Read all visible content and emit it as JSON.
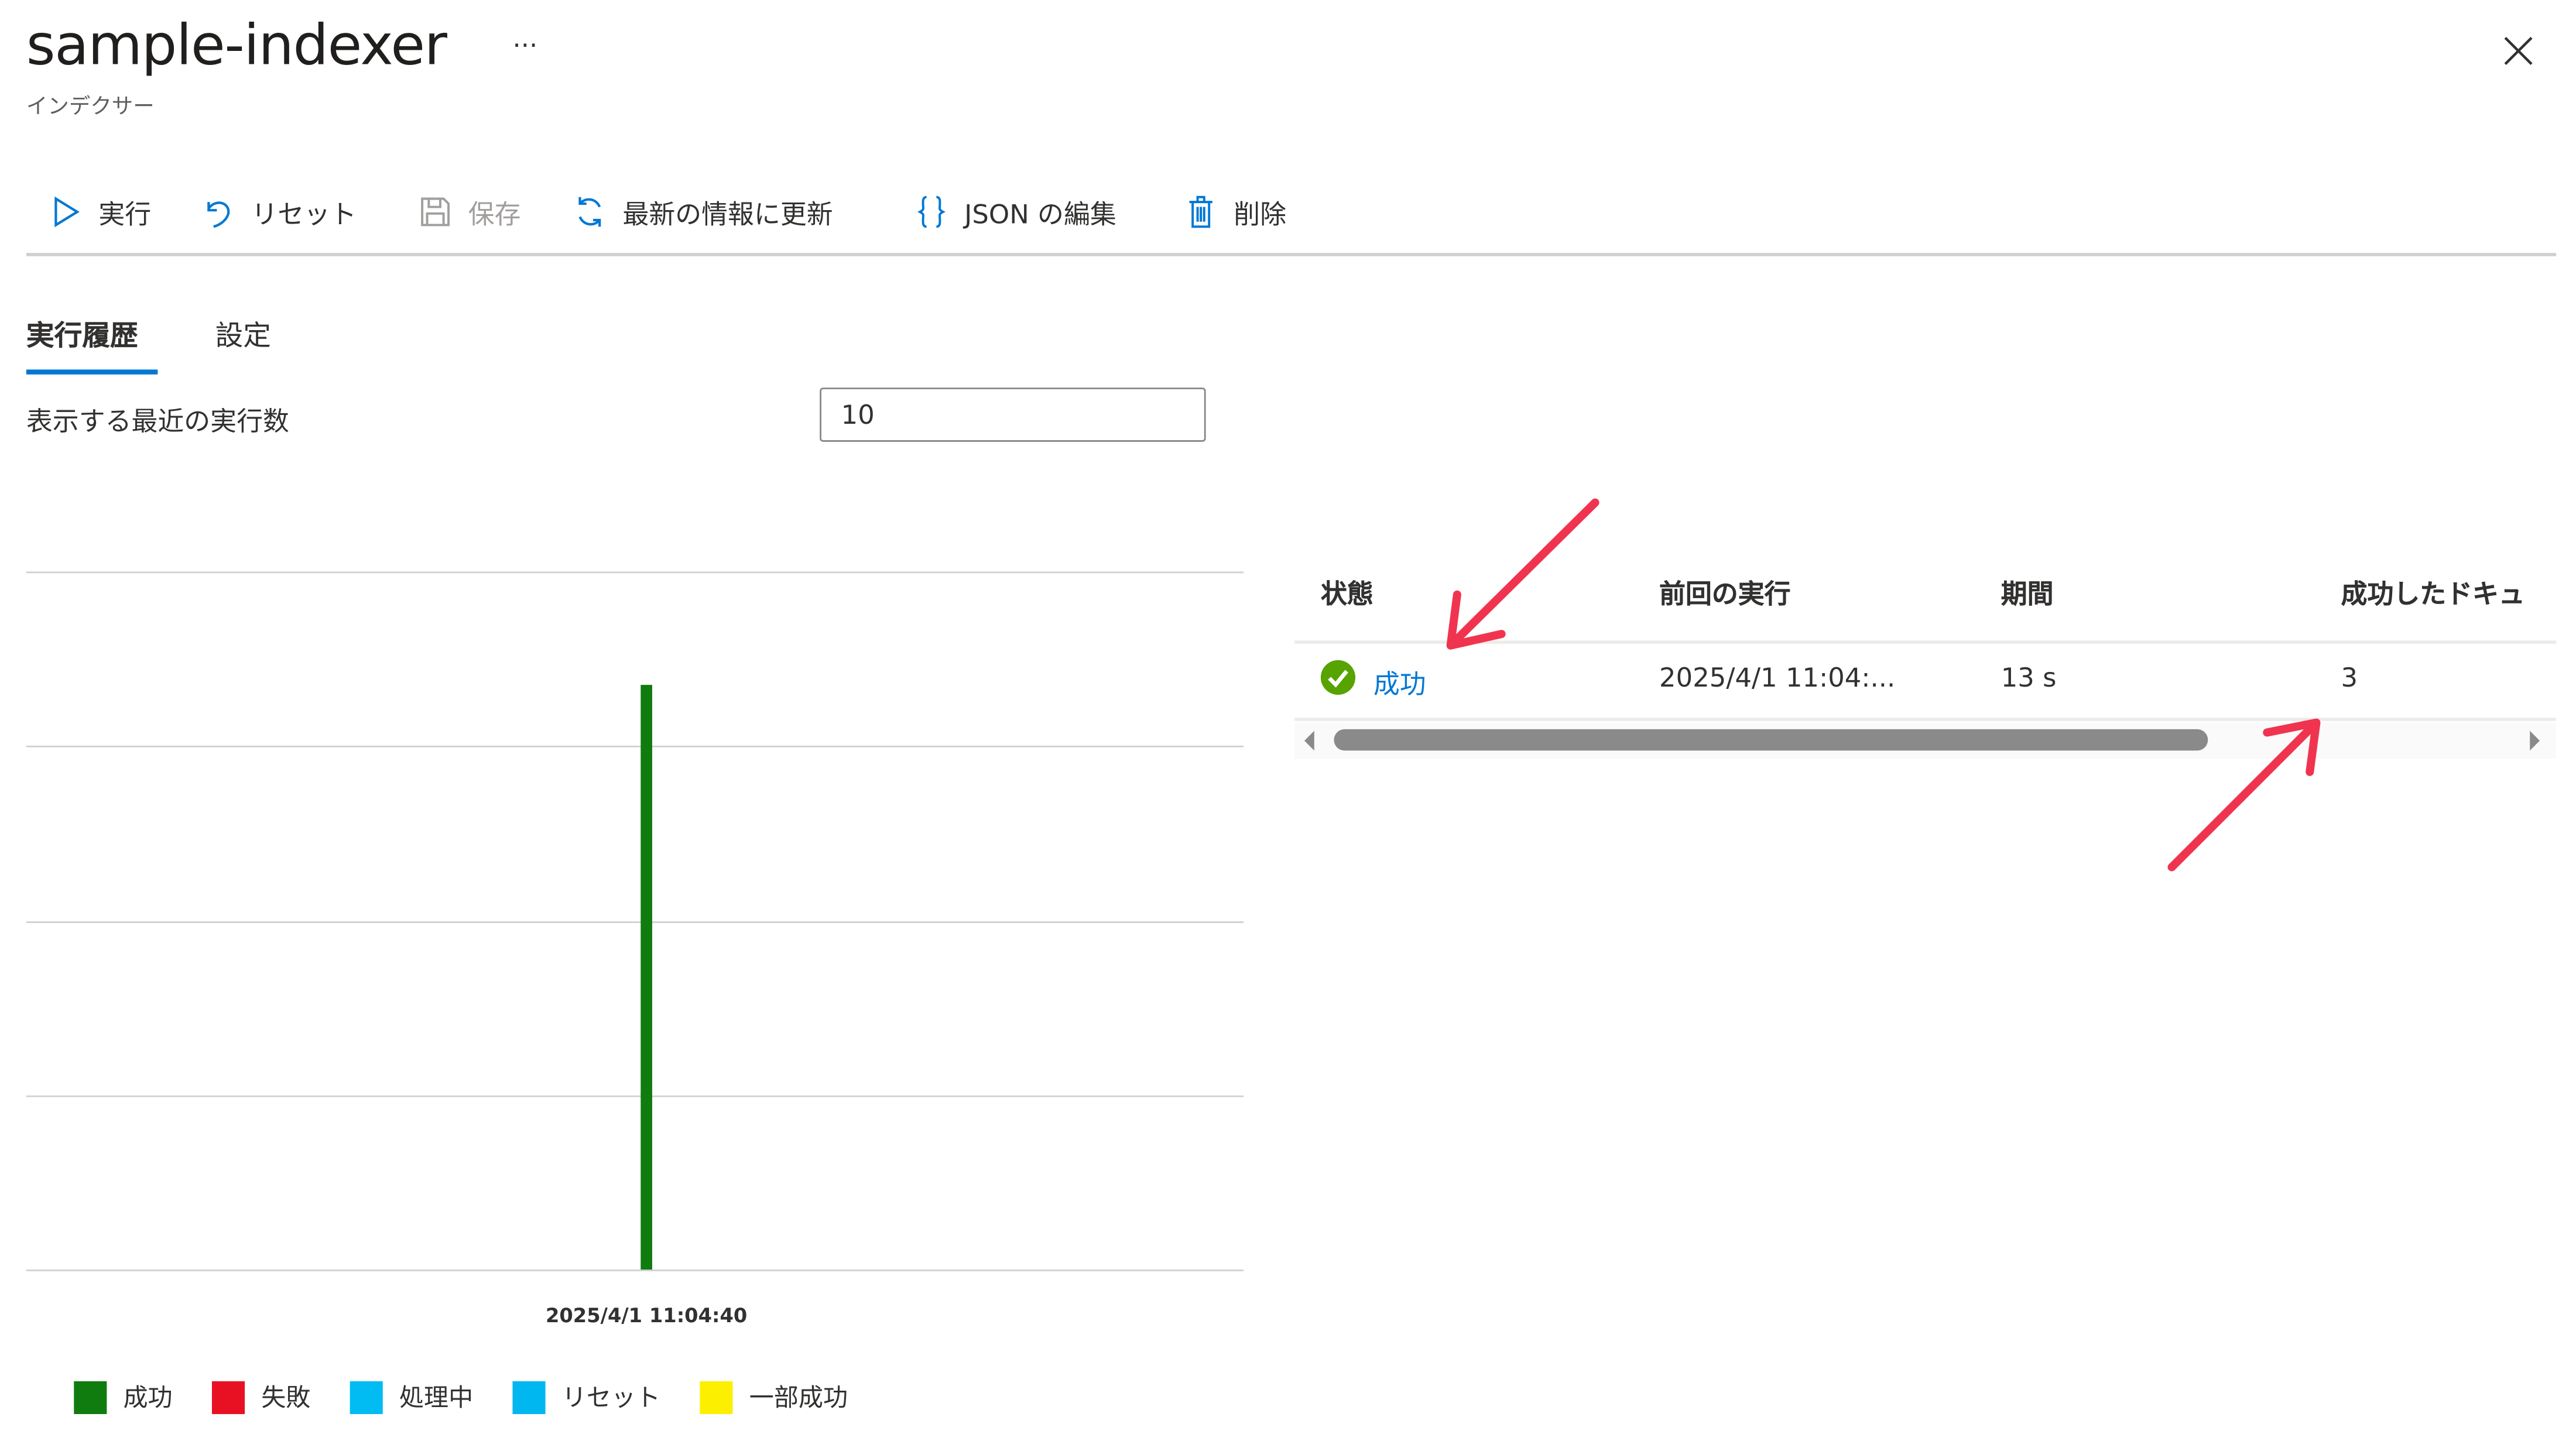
{
  "header": {
    "title": "sample-indexer",
    "more": "···",
    "subtitle": "インデクサー"
  },
  "toolbar": {
    "run": "実行",
    "reset": "リセット",
    "save": "保存",
    "refresh": "最新の情報に更新",
    "edit_json": "JSON の編集",
    "delete": "削除"
  },
  "tabs": [
    {
      "label": "実行履歴",
      "active": true
    },
    {
      "label": "設定",
      "active": false
    }
  ],
  "recent_runs": {
    "label": "表示する最近の実行数",
    "value": "10"
  },
  "chart_data": {
    "type": "bar",
    "categories": [
      "2025/4/1 11:04:40"
    ],
    "series": [
      {
        "status": "成功",
        "color": "#107c10",
        "values": [
          13
        ]
      }
    ],
    "ylim": [
      0,
      15.5
    ],
    "grid": true,
    "legend_placement": "bottom-left",
    "legend": [
      {
        "label": "成功",
        "color": "#107c10"
      },
      {
        "label": "失敗",
        "color": "#e81123"
      },
      {
        "label": "処理中",
        "color": "#00bcf2"
      },
      {
        "label": "リセット",
        "color": "#00b7f0"
      },
      {
        "label": "一部成功",
        "color": "#fcf000"
      }
    ]
  },
  "table": {
    "columns": [
      "状態",
      "前回の実行",
      "期間",
      "成功したドキュ"
    ],
    "rows": [
      {
        "status": "成功",
        "last_run": "2025/4/1 11:04:...",
        "duration": "13 s",
        "succeeded_docs": "3"
      }
    ]
  },
  "annotation_color": "#f0344f"
}
